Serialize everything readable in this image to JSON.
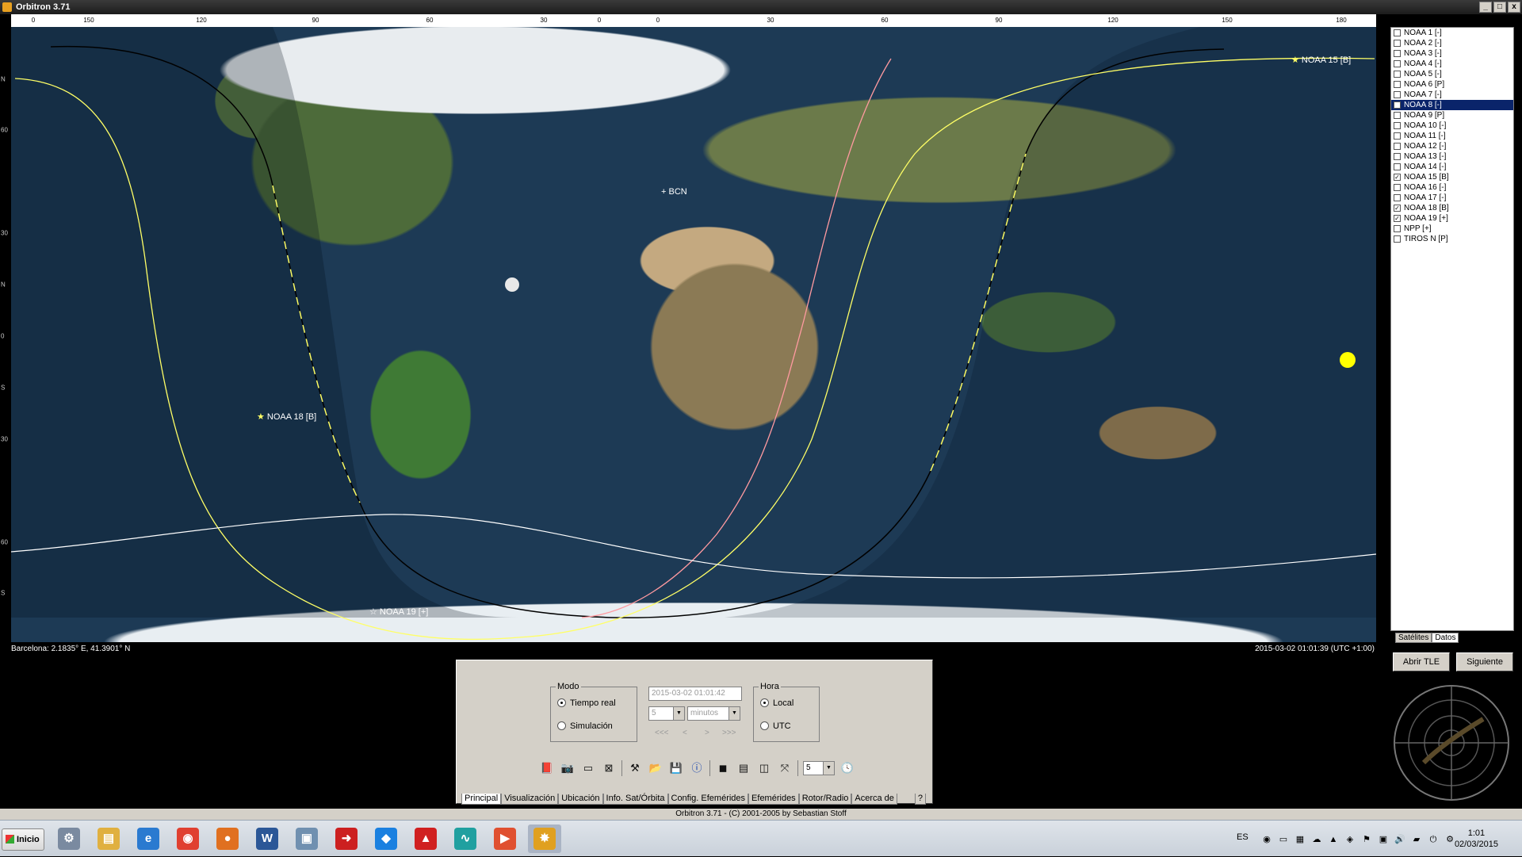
{
  "window": {
    "title": "Orbitron 3.71",
    "min": "_",
    "max": "□",
    "close": "x"
  },
  "lon_ticks": [
    "0",
    "150",
    "120",
    "90",
    "60",
    "30",
    "0",
    "0",
    "30",
    "60",
    "90",
    "120",
    "150",
    "180"
  ],
  "lat_ticks": [
    "N",
    "60",
    "30",
    "N",
    "0",
    "S",
    "30",
    "60",
    "S"
  ],
  "map": {
    "labels": {
      "bcn": "+ BCN",
      "noaa15": "NOAA 15 [B]",
      "noaa18": "NOAA 18 [B]",
      "noaa19": "NOAA 19 [+]"
    },
    "location": "Barcelona: 2.1835° E, 41.3901° N",
    "datetime": "2015-03-02 01:01:39 (UTC +1:00)",
    "colors": {
      "track_yellow": "#ffff66",
      "track_white": "#ffffff",
      "track_pink": "#ff9aa0",
      "terminator": "#000000",
      "sun": "#ffff00",
      "moon": "#e8e8e8"
    }
  },
  "satellites": [
    {
      "name": "NOAA 1 [-]",
      "checked": false
    },
    {
      "name": "NOAA 2 [-]",
      "checked": false
    },
    {
      "name": "NOAA 3 [-]",
      "checked": false
    },
    {
      "name": "NOAA 4 [-]",
      "checked": false
    },
    {
      "name": "NOAA 5 [-]",
      "checked": false
    },
    {
      "name": "NOAA 6 [P]",
      "checked": false
    },
    {
      "name": "NOAA 7 [-]",
      "checked": false
    },
    {
      "name": "NOAA 8 [-]",
      "checked": false,
      "selected": true
    },
    {
      "name": "NOAA 9 [P]",
      "checked": false
    },
    {
      "name": "NOAA 10 [-]",
      "checked": false
    },
    {
      "name": "NOAA 11 [-]",
      "checked": false
    },
    {
      "name": "NOAA 12 [-]",
      "checked": false
    },
    {
      "name": "NOAA 13 [-]",
      "checked": false
    },
    {
      "name": "NOAA 14 [-]",
      "checked": false
    },
    {
      "name": "NOAA 15 [B]",
      "checked": true
    },
    {
      "name": "NOAA 16 [-]",
      "checked": false
    },
    {
      "name": "NOAA 17 [-]",
      "checked": false
    },
    {
      "name": "NOAA 18 [B]",
      "checked": true
    },
    {
      "name": "NOAA 19 [+]",
      "checked": true
    },
    {
      "name": "NPP [+]",
      "checked": false
    },
    {
      "name": "TIROS N [P]",
      "checked": false
    }
  ],
  "sidebar": {
    "tabs": [
      "Satélites",
      "Datos"
    ],
    "open_tle": "Abrir TLE",
    "next": "Siguiente"
  },
  "control": {
    "mode_legend": "Modo",
    "realtime": "Tiempo real",
    "simulation": "Simulación",
    "datetime_value": "2015-03-02 01:01:42",
    "step_value": "5",
    "step_unit": "minutos",
    "nav": [
      "<<<",
      "<",
      ">",
      ">>>"
    ],
    "hour_legend": "Hora",
    "local": "Local",
    "utc": "UTC",
    "speed_value": "5"
  },
  "tabs": [
    "Principal",
    "Visualización",
    "Ubicación",
    "Info. Sat/Órbita",
    "Config. Efemérides",
    "Efemérides",
    "Rotor/Radio",
    "Acerca de",
    "?"
  ],
  "copyright": "Orbitron 3.71 - (C) 2001-2005 by Sebastian Stoff",
  "taskbar": {
    "start": "Inicio",
    "lang": "ES",
    "time": "1:01",
    "date": "02/03/2015"
  }
}
